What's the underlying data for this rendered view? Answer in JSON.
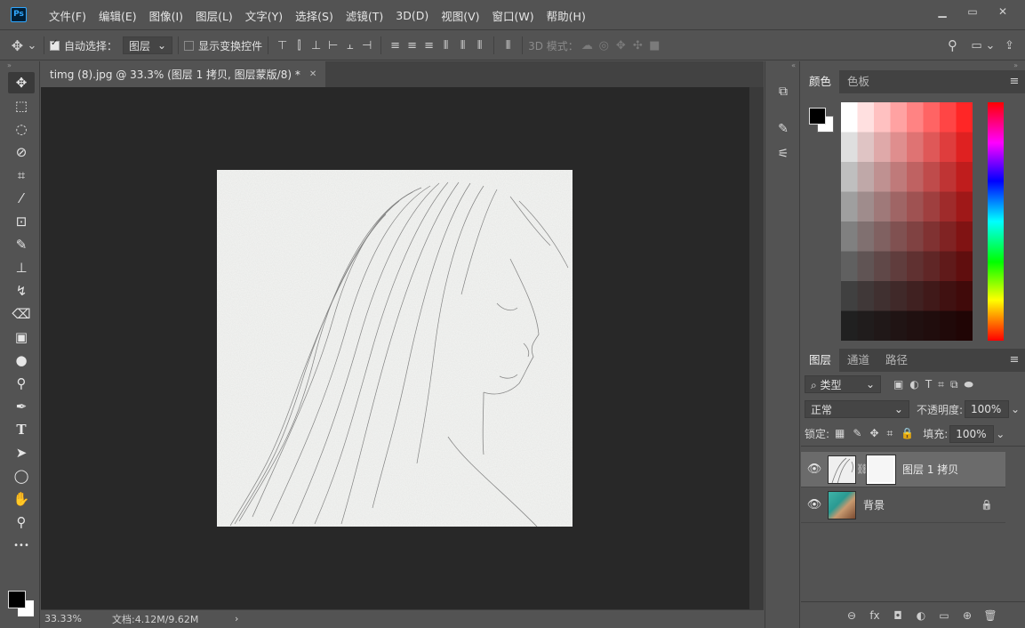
{
  "app": {
    "logo": "Ps"
  },
  "menu": [
    "文件(F)",
    "编辑(E)",
    "图像(I)",
    "图层(L)",
    "文字(Y)",
    "选择(S)",
    "滤镜(T)",
    "3D(D)",
    "视图(V)",
    "窗口(W)",
    "帮助(H)"
  ],
  "window_controls": {
    "minimize": "▁",
    "maximize": "▭",
    "close": "✕"
  },
  "options": {
    "move_icon": "✥",
    "dropdown_arrow": "⌄",
    "auto_select_label": "自动选择：",
    "auto_select_target": "图层",
    "show_transform_label": "显示变换控件",
    "mode_3d_label": "3D 模式："
  },
  "toolbar": {
    "header": "»",
    "tools": [
      {
        "name": "move-tool",
        "glyph": "✥"
      },
      {
        "name": "marquee-tool",
        "glyph": "⬚"
      },
      {
        "name": "lasso-tool",
        "glyph": "◌"
      },
      {
        "name": "quick-select-tool",
        "glyph": "⊘"
      },
      {
        "name": "crop-tool",
        "glyph": "⌗"
      },
      {
        "name": "eyedropper-tool",
        "glyph": "⁄"
      },
      {
        "name": "patch-tool",
        "glyph": "⊡"
      },
      {
        "name": "brush-tool",
        "glyph": "✎"
      },
      {
        "name": "stamp-tool",
        "glyph": "⊥"
      },
      {
        "name": "history-brush-tool",
        "glyph": "↯"
      },
      {
        "name": "eraser-tool",
        "glyph": "⌫"
      },
      {
        "name": "gradient-tool",
        "glyph": "▣"
      },
      {
        "name": "blur-tool",
        "glyph": "●"
      },
      {
        "name": "dodge-tool",
        "glyph": "⚲"
      },
      {
        "name": "pen-tool",
        "glyph": "✒"
      },
      {
        "name": "type-tool",
        "glyph": "T"
      },
      {
        "name": "path-select-tool",
        "glyph": "➤"
      },
      {
        "name": "ellipse-tool",
        "glyph": "◯"
      },
      {
        "name": "hand-tool",
        "glyph": "✋"
      },
      {
        "name": "zoom-tool",
        "glyph": "⚲"
      },
      {
        "name": "more-tools",
        "glyph": "•••"
      }
    ]
  },
  "document": {
    "tab_title": "timg (8).jpg @ 33.3% (图层 1 拷贝, 图层蒙版/8) *",
    "close_glyph": "✕",
    "zoom": "33.33%",
    "doc_size": "文档:4.12M/9.62M",
    "status_arrow": "›"
  },
  "color_panel": {
    "tabs": [
      "颜色",
      "色板"
    ],
    "menu_glyph": "≡"
  },
  "layers_panel": {
    "tabs": [
      "图层",
      "通道",
      "路径"
    ],
    "menu_glyph": "≡",
    "filter_label": "⌕ 类型",
    "blend_mode": "正常",
    "opacity_label": "不透明度:",
    "opacity_value": "100%",
    "lock_label": "锁定:",
    "fill_label": "填充:",
    "fill_value": "100%",
    "layers": [
      {
        "name": "图层 1 拷贝",
        "selected": true
      },
      {
        "name": "背景",
        "selected": false,
        "lock": "🔒"
      }
    ],
    "footer_icons": [
      "⊖",
      "fx",
      "◘",
      "◐",
      "▭",
      "⊕",
      "🗑"
    ]
  },
  "colors": {
    "accent": "#31a8ff",
    "panel": "#535353",
    "canvas": "#282828"
  }
}
